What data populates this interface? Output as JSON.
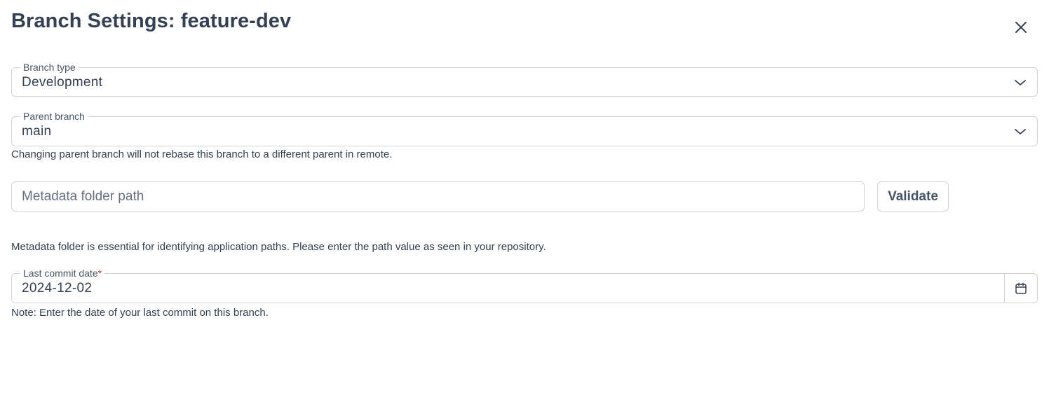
{
  "dialog": {
    "title": "Branch Settings: feature-dev"
  },
  "branch_type": {
    "label": "Branch type",
    "value": "Development"
  },
  "parent_branch": {
    "label": "Parent branch",
    "value": "main",
    "help": "Changing parent branch will not rebase this branch to a different parent in remote."
  },
  "metadata": {
    "placeholder": "Metadata folder path",
    "value": "",
    "validate_label": "Validate",
    "help": "Metadata folder is essential for identifying application paths. Please enter the path value as seen in your repository."
  },
  "last_commit": {
    "label": "Last commit date",
    "required_mark": "*",
    "value": "2024-12-02",
    "help": "Note: Enter the date of your last commit on this branch."
  },
  "icons": {
    "close": "close-icon",
    "chevron": "chevron-down-icon",
    "calendar": "calendar-icon"
  },
  "colors": {
    "text": "#344054",
    "border": "#cfd4dc",
    "required": "#d92d20"
  }
}
